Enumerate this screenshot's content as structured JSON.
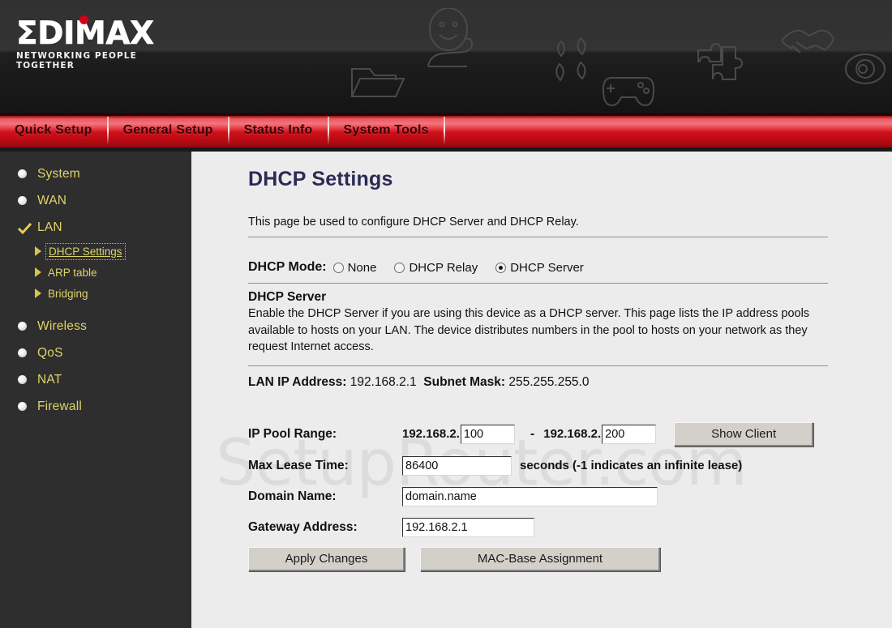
{
  "brand": {
    "logo_text": "ΣDIMAX",
    "tagline": "NETWORKING PEOPLE TOGETHER",
    "accent_red": "#d4001a",
    "header_bg": "#1f1f1f"
  },
  "topnav": {
    "items": [
      {
        "label": "Quick Setup"
      },
      {
        "label": "General Setup"
      },
      {
        "label": "Status Info"
      },
      {
        "label": "System Tools"
      }
    ],
    "bar_color": "#cc1019",
    "text_color": "#3b0206"
  },
  "sidebar": {
    "text_color": "#ded36a",
    "bg_color": "#2e2e2e",
    "items": [
      {
        "label": "System",
        "icon": "bullet-icon",
        "selected": false
      },
      {
        "label": "WAN",
        "icon": "bullet-icon",
        "selected": false
      },
      {
        "label": "LAN",
        "icon": "check-icon",
        "selected": true
      }
    ],
    "sub_items": [
      {
        "label": "DHCP Settings",
        "icon": "arrow-right-icon",
        "selected": true
      },
      {
        "label": "ARP table",
        "icon": "arrow-right-icon",
        "selected": false
      },
      {
        "label": "Bridging",
        "icon": "arrow-right-icon",
        "selected": false
      }
    ],
    "items_after": [
      {
        "label": "Wireless",
        "icon": "bullet-icon",
        "selected": false
      },
      {
        "label": "QoS",
        "icon": "bullet-icon",
        "selected": false
      },
      {
        "label": "NAT",
        "icon": "bullet-icon",
        "selected": false
      },
      {
        "label": "Firewall",
        "icon": "bullet-icon",
        "selected": false
      }
    ]
  },
  "main": {
    "watermark": "SetupRouter.com",
    "title": "DHCP Settings",
    "intro": "This page be used to configure DHCP Server and DHCP Relay.",
    "mode": {
      "label": "DHCP Mode:",
      "options": [
        {
          "label": "None",
          "selected": false
        },
        {
          "label": "DHCP Relay",
          "selected": false
        },
        {
          "label": "DHCP Server",
          "selected": true
        }
      ]
    },
    "section": {
      "heading": "DHCP Server",
      "body": "Enable the DHCP Server if you are using this device as a DHCP server. This page lists the IP address pools available to hosts on your LAN. The device distributes numbers in the pool to hosts on your network as they request Internet access."
    },
    "network": {
      "lan_ip_label": "LAN IP Address:",
      "lan_ip_value": "192.168.2.1",
      "subnet_label": "Subnet Mask:",
      "subnet_value": "255.255.255.0"
    },
    "form": {
      "ip_pool_label": "IP Pool Range:",
      "ip_pool_prefix_start": "192.168.2.",
      "ip_pool_start": "100",
      "ip_pool_dash": "-",
      "ip_pool_prefix_end": "192.168.2.",
      "ip_pool_end": "200",
      "show_client_label": "Show Client",
      "lease_label": "Max Lease Time:",
      "lease_value": "86400",
      "lease_hint": "seconds (-1 indicates an infinite lease)",
      "domain_label": "Domain Name:",
      "domain_value": "domain.name",
      "gateway_label": "Gateway Address:",
      "gateway_value": "192.168.2.1",
      "apply_label": "Apply Changes",
      "mac_label": "MAC-Base Assignment"
    }
  }
}
